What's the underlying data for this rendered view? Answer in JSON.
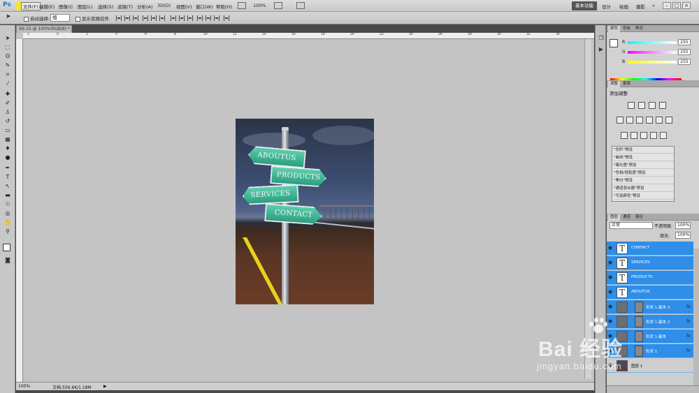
{
  "app": {
    "logo": "Ps",
    "menus": [
      "文件(F)",
      "编辑(E)",
      "图像(I)",
      "图层(L)",
      "选择(S)",
      "滤镜(T)",
      "分析(A)",
      "3D(D)",
      "视图(V)",
      "窗口(W)",
      "帮助(H)"
    ],
    "zoom": "100%",
    "workspace_active": "基本功能",
    "workspaces": [
      "设计",
      "绘画",
      "摄影"
    ],
    "more": "»",
    "window_buttons": [
      "–",
      "□",
      "×"
    ]
  },
  "options": {
    "auto_select_label": "自动选择:",
    "auto_select_value": "组",
    "show_transform_label": "显示变换控件"
  },
  "document": {
    "tab_title": "X6-15 @ 100%(RGB/8) *",
    "ruler_labels": [
      "2",
      "0",
      "2",
      "4",
      "6",
      "8",
      "10",
      "12",
      "14",
      "16",
      "18",
      "20",
      "22",
      "24",
      "26",
      "28",
      "30",
      "32",
      "34"
    ],
    "signs": {
      "aboutus": "ABOUTUS",
      "products": "PRODUCTS",
      "services": "SERVICES",
      "contact": "CONTACT"
    }
  },
  "status": {
    "zoom": "100%",
    "doc_info": "文档:556.6K/1.18M",
    "arrow": "▶"
  },
  "panels": {
    "color_tabs": [
      "颜色",
      "色板",
      "样式"
    ],
    "rgb": [
      {
        "label": "R",
        "value": "255"
      },
      {
        "label": "G",
        "value": "255"
      },
      {
        "label": "B",
        "value": "255"
      }
    ],
    "adjust_tabs": [
      "调整",
      "蒙版"
    ],
    "adjust_title": "添加调整",
    "presets": [
      "\"色阶\"预设",
      "\"曲线\"预设",
      "\"曝光度\"预设",
      "\"色相/饱和度\"预设",
      "\"黑白\"预设",
      "\"通道混合器\"预设",
      "\"可选颜色\"预设"
    ],
    "layer_tabs": [
      "图层",
      "通道",
      "路径"
    ],
    "blend_mode": "正常",
    "opacity_label": "不透明度:",
    "opacity_value": "100%",
    "fill_label": "填充:",
    "fill_value": "100%",
    "layers": [
      {
        "name": "CONTACT",
        "kind": "text"
      },
      {
        "name": "SERVICES",
        "kind": "text"
      },
      {
        "name": "PRODUCTS",
        "kind": "text"
      },
      {
        "name": "ABOUTUS",
        "kind": "text"
      },
      {
        "name": "形状 1 副本 3",
        "kind": "shape"
      },
      {
        "name": "形状 1 副本 2",
        "kind": "shape"
      },
      {
        "name": "形状 1 副本",
        "kind": "shape"
      },
      {
        "name": "形状 1",
        "kind": "shape"
      },
      {
        "name": "图层 1",
        "kind": "image"
      }
    ],
    "fx": "fx",
    "text_thumb": "T"
  },
  "watermark": {
    "brand": "Bai 经验",
    "url": "jingyan.baidu.com"
  },
  "colors": {
    "selection_blue": "#2e8ee8",
    "sign_green": "#3bb594",
    "road_yellow": "#e8d21c"
  }
}
